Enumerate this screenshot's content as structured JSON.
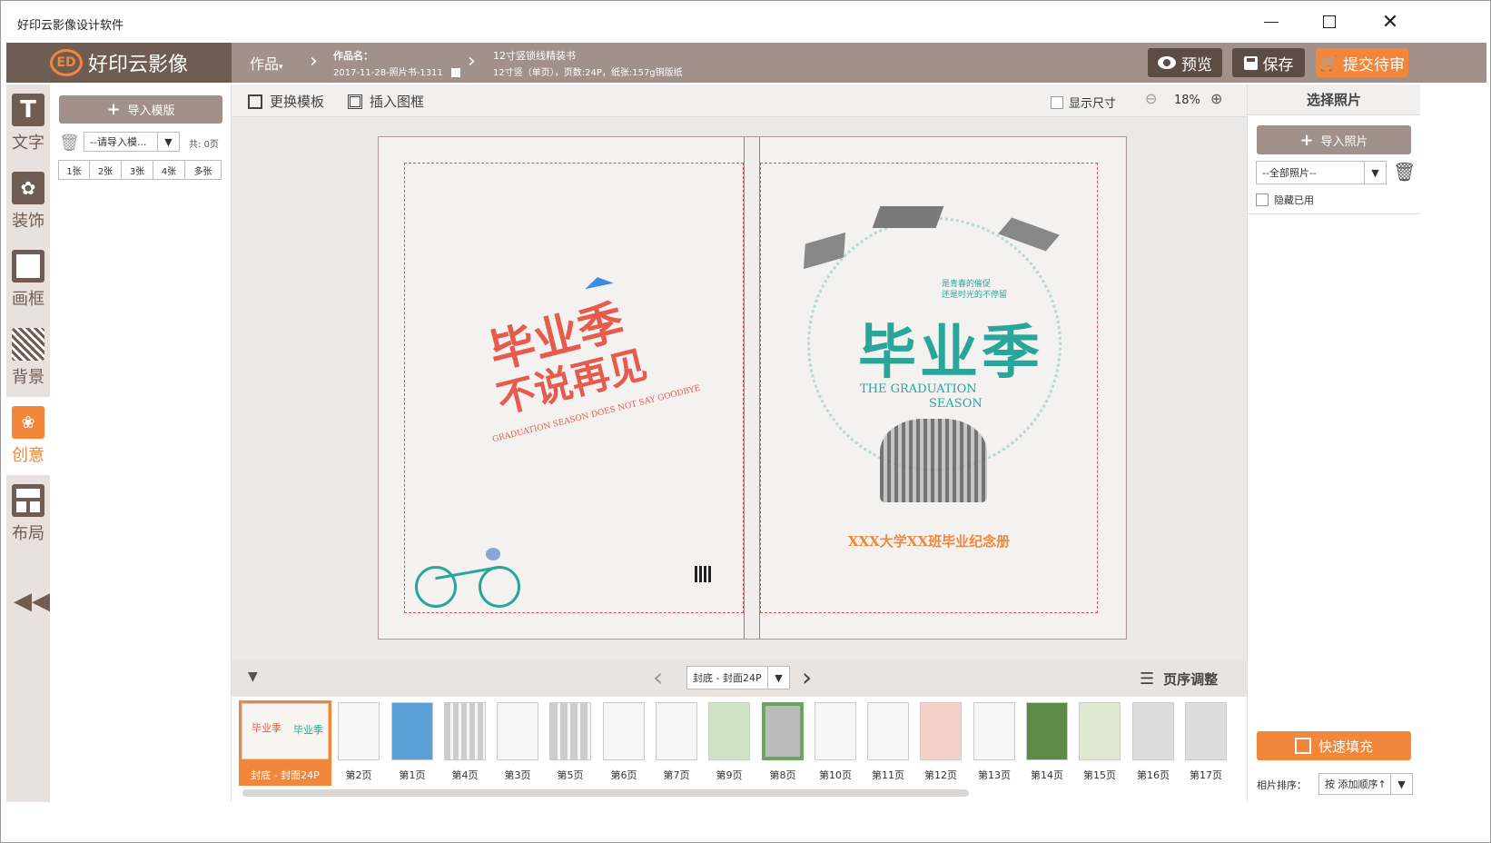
{
  "window": {
    "title": "好印云影像设计软件"
  },
  "header": {
    "logo_text": "好印云影像",
    "works_menu": "作品",
    "work_name_label": "作品名：",
    "work_name": "2017-11-28-照片书-1311",
    "product_title": "12寸竖锁线精装书",
    "product_detail": "12寸竖（单页），页数:24P，纸张:157g铜版纸",
    "preview_label": "预览",
    "save_label": "保存",
    "submit_label": "提交待审"
  },
  "tools": [
    {
      "label": "文字",
      "icon": "text-icon"
    },
    {
      "label": "装饰",
      "icon": "decoration-icon"
    },
    {
      "label": "画框",
      "icon": "frame-icon"
    },
    {
      "label": "背景",
      "icon": "background-icon"
    },
    {
      "label": "创意",
      "icon": "creative-icon"
    },
    {
      "label": "布局",
      "icon": "layout-icon"
    }
  ],
  "template_panel": {
    "import_label": "导入模版",
    "select_placeholder": "--请导入模...",
    "count": "共: 0页",
    "filters": [
      "1张",
      "2张",
      "3张",
      "4张",
      "多张"
    ]
  },
  "canvas_toolbar": {
    "change_template": "更换模板",
    "insert_frame": "插入图框",
    "show_size": "显示尺寸",
    "zoom": "18%"
  },
  "cover": {
    "back_title_1": "毕业季",
    "back_title_2": "不说再见",
    "back_subtitle": "GRADUATION SEASON DOES NOT SAY GOODBYE",
    "front_small_1": "是青春的催促",
    "front_small_2": "还是时光的不停留",
    "front_title": "毕业季",
    "front_en_1": "THE GRADUATION",
    "front_en_2": "SEASON",
    "front_caption": "XXX大学XX班毕业纪念册"
  },
  "right_panel": {
    "title": "选择照片",
    "import_label": "导入照片",
    "filter_value": "--全部照片--",
    "hide_used": "隐藏已用",
    "quick_fill": "快速填充",
    "sort_label": "相片排序：",
    "sort_value": "按 添加顺序↑"
  },
  "page_nav": {
    "current": "封底 - 封面24P",
    "page_order": "页序调整"
  },
  "pages": [
    "封底 - 封面24P",
    "第2页",
    "第1页",
    "第4页",
    "第3页",
    "第5页",
    "第6页",
    "第7页",
    "第9页",
    "第8页",
    "第10页",
    "第11页",
    "第12页",
    "第13页",
    "第14页",
    "第15页",
    "第16页",
    "第17页"
  ],
  "colors": {
    "brand": "#6f5c52",
    "header": "#a1918a",
    "accent": "#f2863b",
    "teal": "#2aa59a",
    "red": "#e55b4d"
  }
}
